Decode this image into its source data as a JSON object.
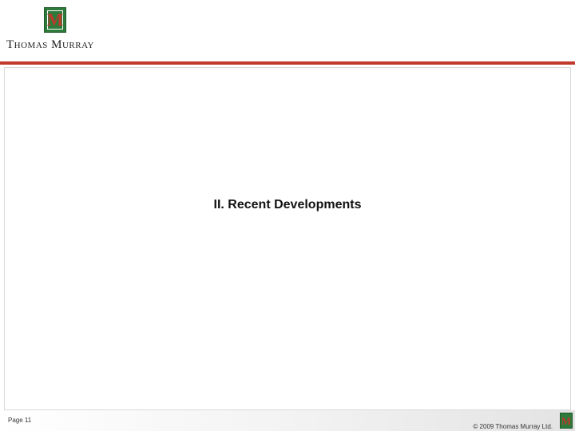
{
  "header": {
    "logo_letter": "M",
    "brand_name": "Thomas Murray"
  },
  "slide": {
    "section_title": "II. Recent Developments"
  },
  "footer": {
    "page_label": "Page 11",
    "copyright": "© 2009 Thomas Murray Ltd.",
    "logo_letter": "M"
  },
  "colors": {
    "brand_green": "#2e7a3b",
    "brand_red": "#c0392b"
  }
}
